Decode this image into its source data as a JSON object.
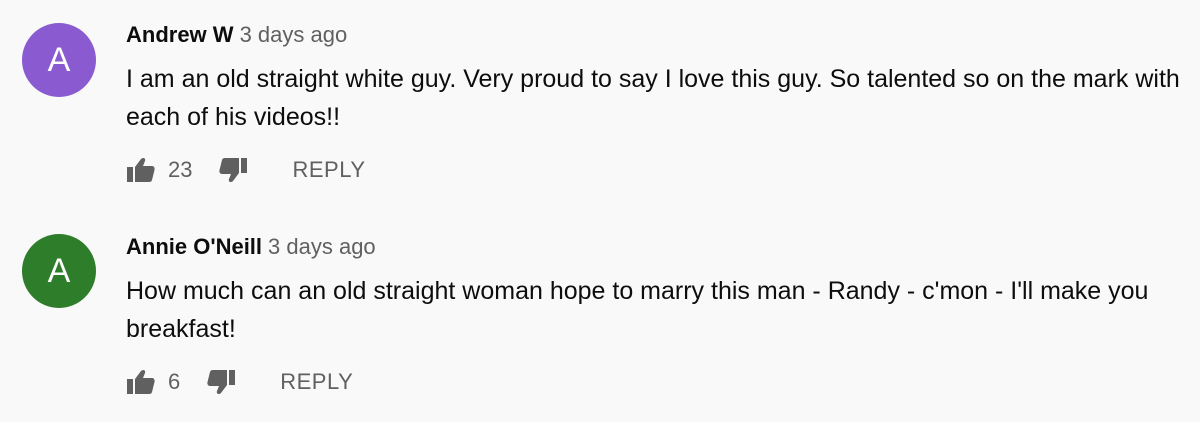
{
  "comments": [
    {
      "avatar_letter": "A",
      "avatar_color": "#8a5bd0",
      "author": "Andrew W",
      "time": "3 days ago",
      "text": "I am an old straight white guy. Very proud to say I love this guy. So talented so on the mark with each of his videos!!",
      "likes": "23",
      "reply_label": "REPLY"
    },
    {
      "avatar_letter": "A",
      "avatar_color": "#2e7d2a",
      "author": "Annie O'Neill",
      "time": "3 days ago",
      "text": "How much can an old straight woman hope to marry this man - Randy - c'mon - I'll make you breakfast!",
      "likes": "6",
      "reply_label": "REPLY"
    }
  ],
  "icons": {
    "like": "thumbs-up-icon",
    "dislike": "thumbs-down-icon"
  }
}
